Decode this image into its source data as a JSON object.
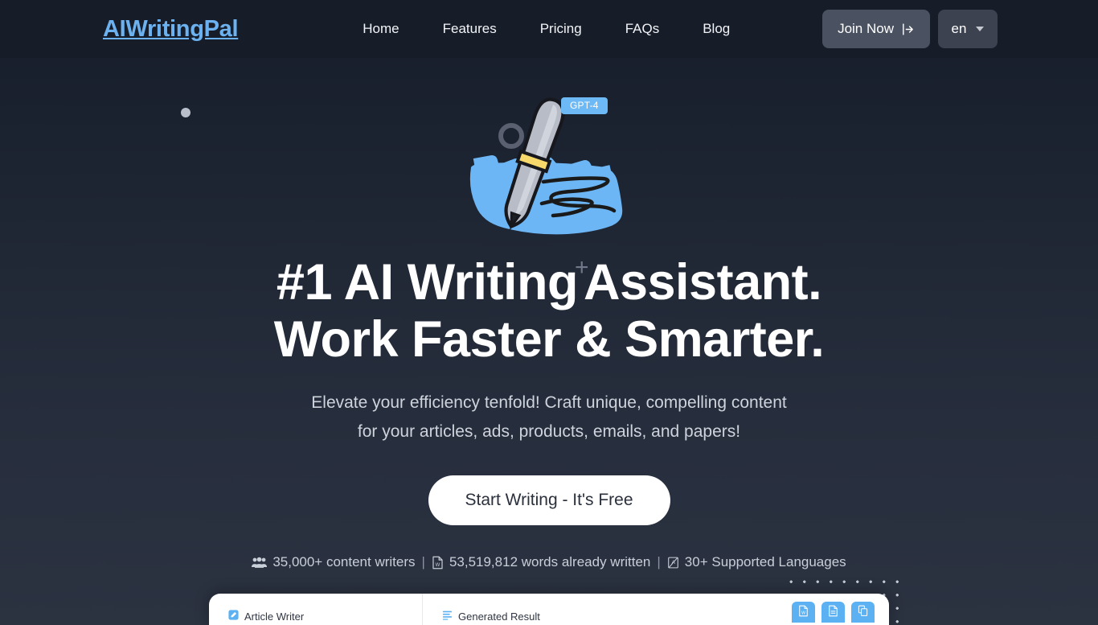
{
  "nav": {
    "brand": "AIWritingPal",
    "links": [
      {
        "label": "Home"
      },
      {
        "label": "Features"
      },
      {
        "label": "Pricing"
      },
      {
        "label": "FAQs"
      },
      {
        "label": "Blog"
      }
    ],
    "join_label": "Join Now",
    "join_icon": "sign-in-icon",
    "language_value": "en",
    "language_caret_icon": "chevron-down-icon"
  },
  "hero": {
    "badge": "GPT-4",
    "illustration_icon": "pen-writing-illustration",
    "headline_line1_a": "#1 AI Writing",
    "headline_plus": "+",
    "headline_line1_b": "Assistant.",
    "headline_line2": "Work Faster & Smarter.",
    "sub_line1": "Elevate your efficiency tenfold! Craft unique, compelling content",
    "sub_line2": "for your articles, ads, products, emails, and papers!",
    "cta_label": "Start Writing - It's Free",
    "stats": {
      "writers_icon": "users-group-icon",
      "writers": "35,000+ content writers",
      "sep1": "|",
      "words_icon": "word-document-icon",
      "words": "53,519,812 words already written",
      "sep2": "|",
      "languages_icon": "translate-icon",
      "languages": "30+ Supported Languages"
    }
  },
  "panel": {
    "left_icon": "pencil-edit-icon",
    "left_label": "Article Writer",
    "right_icon": "list-lines-icon",
    "right_label": "Generated Result",
    "actions": [
      {
        "name": "export-word-button",
        "icon": "word-file-icon"
      },
      {
        "name": "export-doc-button",
        "icon": "document-file-icon"
      },
      {
        "name": "copy-button",
        "icon": "copy-icon"
      }
    ]
  },
  "colors": {
    "brand": "#6cb2f0",
    "badge": "#6cb9f5",
    "accent_blue": "#5cb1f2",
    "bg_top": "#171d2a",
    "bg_bottom": "#2b3240",
    "navbar": "#161d29"
  }
}
